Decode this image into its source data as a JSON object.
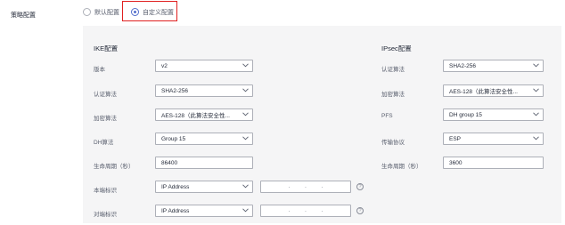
{
  "strategy": {
    "label": "策略配置",
    "options": [
      {
        "label": "默认配置",
        "checked": false
      },
      {
        "label": "自定义配置",
        "checked": true
      }
    ],
    "highlight_color": "#e02020",
    "accent_color": "#526ecc"
  },
  "ike": {
    "title": "IKE配置",
    "version_label": "版本",
    "version_value": "v2",
    "auth_label": "认证算法",
    "auth_value": "SHA2-256",
    "enc_label": "加密算法",
    "enc_value": "AES-128（此算法安全性...",
    "dh_label": "DH算法",
    "dh_value": "Group 15",
    "lifetime_label": "生命周期（秒）",
    "lifetime_value": "86400",
    "local_id_label": "本端标识",
    "local_id_type": "IP Address",
    "local_ip": [
      "·",
      "·",
      "·"
    ],
    "peer_id_label": "对端标识",
    "peer_id_type": "IP Address",
    "peer_ip": [
      "·",
      "·",
      "·"
    ],
    "help_symbol": "?"
  },
  "ipsec": {
    "title": "IPsec配置",
    "auth_label": "认证算法",
    "auth_value": "SHA2-256",
    "enc_label": "加密算法",
    "enc_value": "AES-128（此算法安全性...",
    "pfs_label": "PFS",
    "pfs_value": "DH group 15",
    "protocol_label": "传输协议",
    "protocol_value": "ESP",
    "lifetime_label": "生命周期（秒）",
    "lifetime_value": "3600"
  }
}
